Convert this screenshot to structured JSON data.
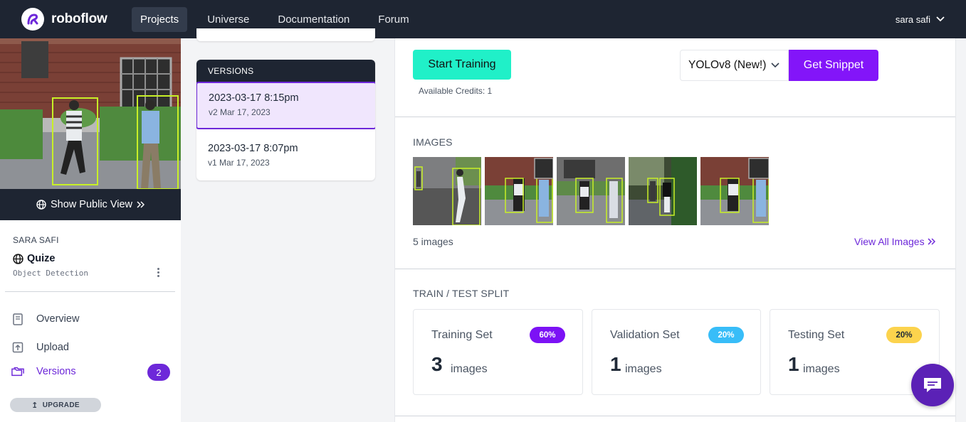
{
  "brand": {
    "name": "roboflow"
  },
  "nav": {
    "items": [
      "Projects",
      "Universe",
      "Documentation",
      "Forum"
    ],
    "active": "Projects"
  },
  "user": {
    "name": "sara safi"
  },
  "sidebar": {
    "public_view_label": "Show Public View",
    "owner": "SARA SAFI",
    "project_name": "Quize",
    "project_type": "Object Detection",
    "menu": [
      {
        "label": "Overview",
        "icon": "book-icon"
      },
      {
        "label": "Upload",
        "icon": "upload-icon"
      },
      {
        "label": "Versions",
        "icon": "folders-icon",
        "badge": "2",
        "active": true
      }
    ],
    "upgrade_label": "UPGRADE"
  },
  "versions": {
    "header": "VERSIONS",
    "items": [
      {
        "name": "2023-03-17 8:15pm",
        "sub": "v2 Mar 17, 2023",
        "selected": true
      },
      {
        "name": "2023-03-17 8:07pm",
        "sub": "v1 Mar 17, 2023",
        "selected": false
      }
    ]
  },
  "main": {
    "start_training_label": "Start Training",
    "credits_text": "Available Credits: 1",
    "model_select_value": "YOLOv8 (New!)",
    "get_snippet_label": "Get Snippet",
    "images_title": "IMAGES",
    "images_count_text": "5 images",
    "view_all_label": "View All Images",
    "split_title": "TRAIN / TEST SPLIT",
    "splits": [
      {
        "name": "Training Set",
        "pct": "60%",
        "count": "3",
        "unit": "images",
        "color": "#7c12f5",
        "text_color": "#ffffff"
      },
      {
        "name": "Validation Set",
        "pct": "20%",
        "count": "1",
        "unit": "images",
        "color": "#38bdf8",
        "text_color": "#ffffff"
      },
      {
        "name": "Testing Set",
        "pct": "20%",
        "count": "1",
        "unit": "images",
        "color": "#fcd34d",
        "text_color": "#1f2937"
      }
    ]
  },
  "colors": {
    "nav_bg": "#1e2532",
    "accent_purple": "#6d28d9",
    "snippet_purple": "#8315f9",
    "train_teal": "#20f0c8"
  }
}
